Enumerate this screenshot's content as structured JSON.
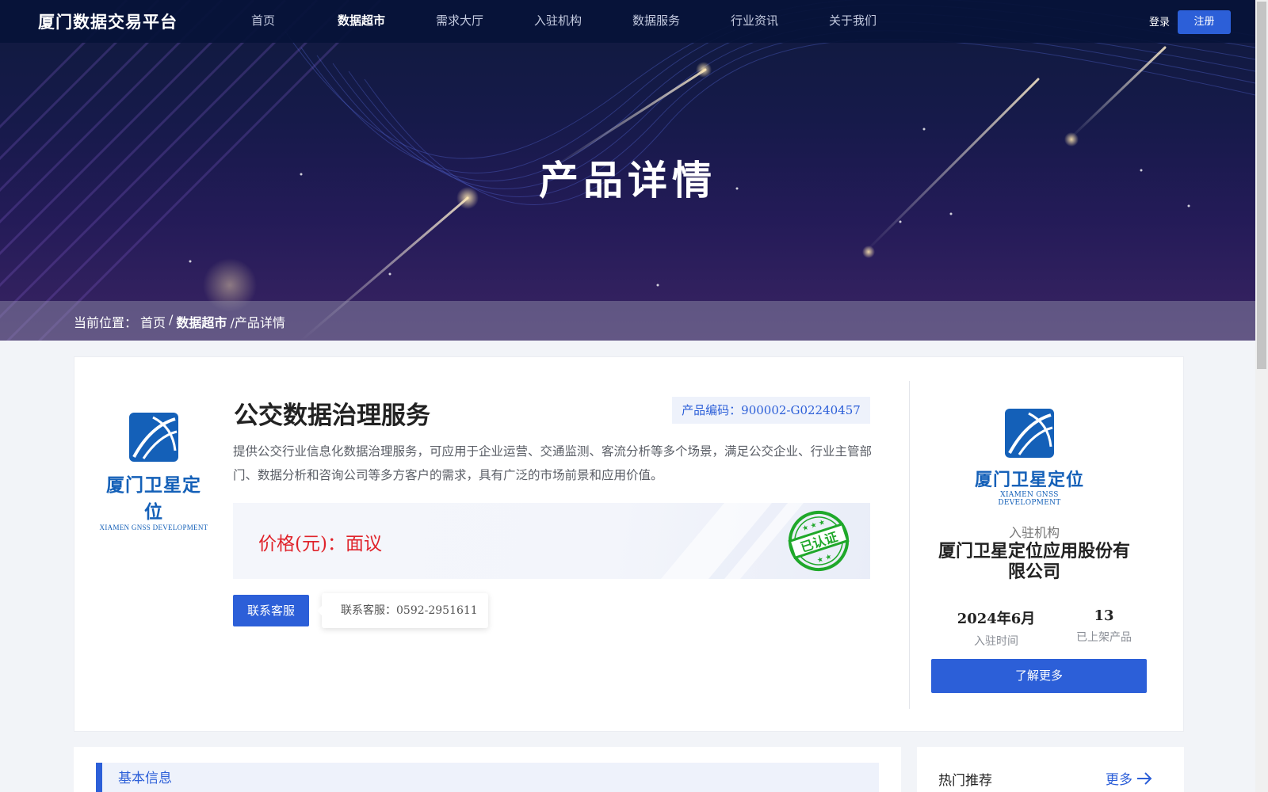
{
  "nav": {
    "logo": "厦门数据交易平台",
    "items": [
      {
        "label": "首页",
        "active": false
      },
      {
        "label": "数据超市",
        "active": true
      },
      {
        "label": "需求大厅",
        "active": false
      },
      {
        "label": "入驻机构",
        "active": false
      },
      {
        "label": "数据服务",
        "active": false
      },
      {
        "label": "行业资讯",
        "active": false
      },
      {
        "label": "关于我们",
        "active": false
      }
    ],
    "login": "登录",
    "register": "注册"
  },
  "hero": {
    "title": "产品详情"
  },
  "breadcrumb": {
    "prefix": "当前位置：",
    "home": "首页",
    "sep": "/",
    "market": "数据超市",
    "current": "/产品详情"
  },
  "product": {
    "logo_cn": "厦门卫星定位",
    "logo_en": "XIAMEN GNSS DEVELOPMENT",
    "title": "公交数据治理服务",
    "code": "产品编码：900002-G02240457",
    "description": "提供公交行业信息化数据治理服务，可应用于企业运营、交通监测、客流分析等多个场景，满足公交企业、行业主管部门、数据分析和咨询公司等多方客户的需求，具有广泛的市场前景和应用价值。",
    "price": "价格(元)：面议",
    "stamp": "已认证",
    "contact_button": "联系客服",
    "contact_tip": "联系客服：0592-2951611"
  },
  "org": {
    "logo_cn": "厦门卫星定位",
    "logo_en": "XIAMEN GNSS DEVELOPMENT",
    "label": "入驻机构",
    "name": "厦门卫星定位应用股份有限公司",
    "stats": [
      {
        "value": "2024年6月",
        "label": "入驻时间"
      },
      {
        "value": "13",
        "label": "已上架产品"
      }
    ],
    "more_button": "了解更多"
  },
  "basic": {
    "title": "基本信息"
  },
  "hot": {
    "title": "热门推荐",
    "more": "更多"
  },
  "colors": {
    "accent": "#2c5fd8",
    "logo_blue": "#1460b8",
    "price_red": "#e0242b",
    "stamp_green": "#1fa82a"
  }
}
